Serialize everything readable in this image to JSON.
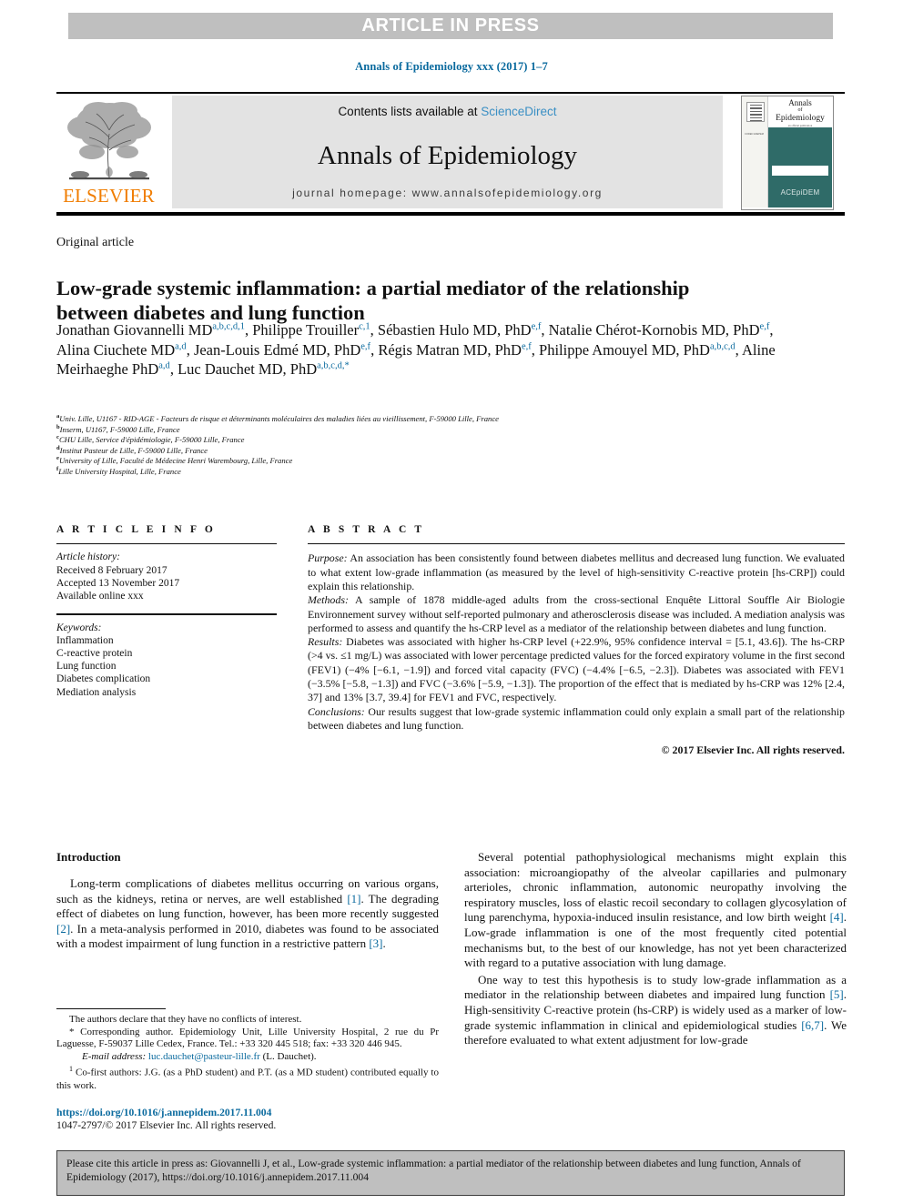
{
  "banner": {
    "text": "ARTICLE IN PRESS"
  },
  "running_head": {
    "text": "Annals of Epidemiology xxx (2017) 1–7"
  },
  "masthead": {
    "contents_prefix": "Contents lists available at ",
    "sciencedirect": "ScienceDirect",
    "journal_name": "Annals of Epidemiology",
    "homepage": "journal homepage: www.annalsofepidemiology.org",
    "publisher_name": "ELSEVIER",
    "cover": {
      "line1": "Annals",
      "line2": "of",
      "line3": "Epidemiology",
      "line4": "an official publication",
      "side_text": "CODEN ANEPEM",
      "ace_label": "ACEpiDEM"
    }
  },
  "article": {
    "type": "Original article",
    "title": "Low-grade systemic inflammation: a partial mediator of the relationship between diabetes and lung function",
    "authors": [
      {
        "name": "Jonathan Giovannelli MD",
        "marks": "a,b,c,d,1",
        "sep": ", "
      },
      {
        "name": "Philippe Trouiller",
        "marks": "c,1",
        "sep": ", "
      },
      {
        "name": "Sébastien Hulo MD, PhD",
        "marks": "e,f",
        "sep": ", "
      },
      {
        "name": "Natalie Chérot-Kornobis MD, PhD",
        "marks": "e,f",
        "sep": ", "
      },
      {
        "name": "Alina Ciuchete MD",
        "marks": "a,d",
        "sep": ", "
      },
      {
        "name": "Jean-Louis Edmé MD, PhD",
        "marks": "e,f",
        "sep": ", "
      },
      {
        "name": "Régis Matran MD, PhD",
        "marks": "e,f",
        "sep": ", "
      },
      {
        "name": "Philippe Amouyel MD, PhD",
        "marks": "a,b,c,d",
        "sep": ", "
      },
      {
        "name": "Aline Meirhaeghe PhD",
        "marks": "a,d",
        "sep": ", "
      },
      {
        "name": "Luc Dauchet MD, PhD",
        "marks": "a,b,c,d,*",
        "sep": ""
      }
    ],
    "affiliations": [
      {
        "mark": "a",
        "text": "Univ. Lille, U1167 - RID-AGE - Facteurs de risque et déterminants moléculaires des maladies liées au vieillissement, F-59000 Lille, France"
      },
      {
        "mark": "b",
        "text": "Inserm, U1167, F-59000 Lille, France"
      },
      {
        "mark": "c",
        "text": "CHU Lille, Service d'épidémiologie, F-59000 Lille, France"
      },
      {
        "mark": "d",
        "text": "Institut Pasteur de Lille, F-59000 Lille, France"
      },
      {
        "mark": "e",
        "text": "University of Lille, Faculté de Médecine Henri Warembourg, Lille, France"
      },
      {
        "mark": "f",
        "text": "Lille University Hospital, Lille, France"
      }
    ]
  },
  "article_info": {
    "heading": "A R T I C L E  I N F O",
    "history_label": "Article history:",
    "history": [
      "Received 8 February 2017",
      "Accepted 13 November 2017",
      "Available online xxx"
    ],
    "keywords_label": "Keywords:",
    "keywords": [
      "Inflammation",
      "C-reactive protein",
      "Lung function",
      "Diabetes complication",
      "Mediation analysis"
    ]
  },
  "abstract": {
    "heading": "A B S T R A C T",
    "purpose_label": "Purpose:",
    "purpose": " An association has been consistently found between diabetes mellitus and decreased lung function. We evaluated to what extent low-grade inflammation (as measured by the level of high-sensitivity C-reactive protein [hs-CRP]) could explain this relationship.",
    "methods_label": "Methods:",
    "methods": " A sample of 1878 middle-aged adults from the cross-sectional Enquête Littoral Souffle Air Biologie Environnement survey without self-reported pulmonary and atherosclerosis disease was included. A mediation analysis was performed to assess and quantify the hs-CRP level as a mediator of the relationship between diabetes and lung function.",
    "results_label": "Results:",
    "results": " Diabetes was associated with higher hs-CRP level (+22.9%, 95% confidence interval = [5.1, 43.6]). The hs-CRP (>4 vs. ≤1 mg/L) was associated with lower percentage predicted values for the forced expiratory volume in the first second (FEV1) (−4% [−6.1, −1.9]) and forced vital capacity (FVC) (−4.4% [−6.5, −2.3]). Diabetes was associated with FEV1 (−3.5% [−5.8, −1.3]) and FVC (−3.6% [−5.9, −1.3]). The proportion of the effect that is mediated by hs-CRP was 12% [2.4, 37] and 13% [3.7, 39.4] for FEV1 and FVC, respectively.",
    "conclusions_label": "Conclusions:",
    "conclusions": " Our results suggest that low-grade systemic inflammation could only explain a small part of the relationship between diabetes and lung function.",
    "copyright": "© 2017 Elsevier Inc. All rights reserved."
  },
  "body": {
    "section_heading": "Introduction",
    "left_paragraphs": [
      "Long-term complications of diabetes mellitus occurring on various organs, such as the kidneys, retina or nerves, are well established [1]. The degrading effect of diabetes on lung function, however, has been more recently suggested [2]. In a meta-analysis performed in 2010, diabetes was found to be associated with a modest impairment of lung function in a restrictive pattern [3]."
    ],
    "right_paragraphs": [
      "Several potential pathophysiological mechanisms might explain this association: microangiopathy of the alveolar capillaries and pulmonary arterioles, chronic inflammation, autonomic neuropathy involving the respiratory muscles, loss of elastic recoil secondary to collagen glycosylation of lung parenchyma, hypoxia-induced insulin resistance, and low birth weight [4]. Low-grade inflammation is one of the most frequently cited potential mechanisms but, to the best of our knowledge, has not yet been characterized with regard to a putative association with lung damage.",
      "One way to test this hypothesis is to study low-grade inflammation as a mediator in the relationship between diabetes and impaired lung function [5]. High-sensitivity C-reactive protein (hs-CRP) is widely used as a marker of low-grade systemic inflammation in clinical and epidemiological studies [6,7]. We therefore evaluated to what extent adjustment for low-grade"
    ]
  },
  "footnotes": {
    "conflict": "The authors declare that they have no conflicts of interest.",
    "corresponding": "* Corresponding author. Epidemiology Unit, Lille University Hospital, 2 rue du Pr Laguesse, F-59037 Lille Cedex, France. Tel.: +33 320 445 518; fax: +33 320 446 945.",
    "email_label": "E-mail address:",
    "email": "luc.dauchet@pasteur-lille.fr",
    "email_suffix": " (L. Dauchet).",
    "cofirst_mark": "1",
    "cofirst": " Co-first authors: J.G. (as a PhD student) and P.T. (as a MD student) contributed equally to this work.",
    "doi": "https://doi.org/10.1016/j.annepidem.2017.11.004",
    "issn_copyright": "1047-2797/© 2017 Elsevier Inc. All rights reserved."
  },
  "citation_box": {
    "text": "Please cite this article in press as: Giovannelli J, et al., Low-grade systemic inflammation: a partial mediator of the relationship between diabetes and lung function, Annals of Epidemiology (2017), https://doi.org/10.1016/j.annepidem.2017.11.004"
  },
  "colors": {
    "banner_bg": "#bfbfbf",
    "link_blue": "#0a6a9e",
    "sciencedirect_blue": "#3a8fc4",
    "elsevier_orange": "#f07d00",
    "masthead_bg": "#e3e3e3",
    "cover_teal": "#2f6b68"
  }
}
